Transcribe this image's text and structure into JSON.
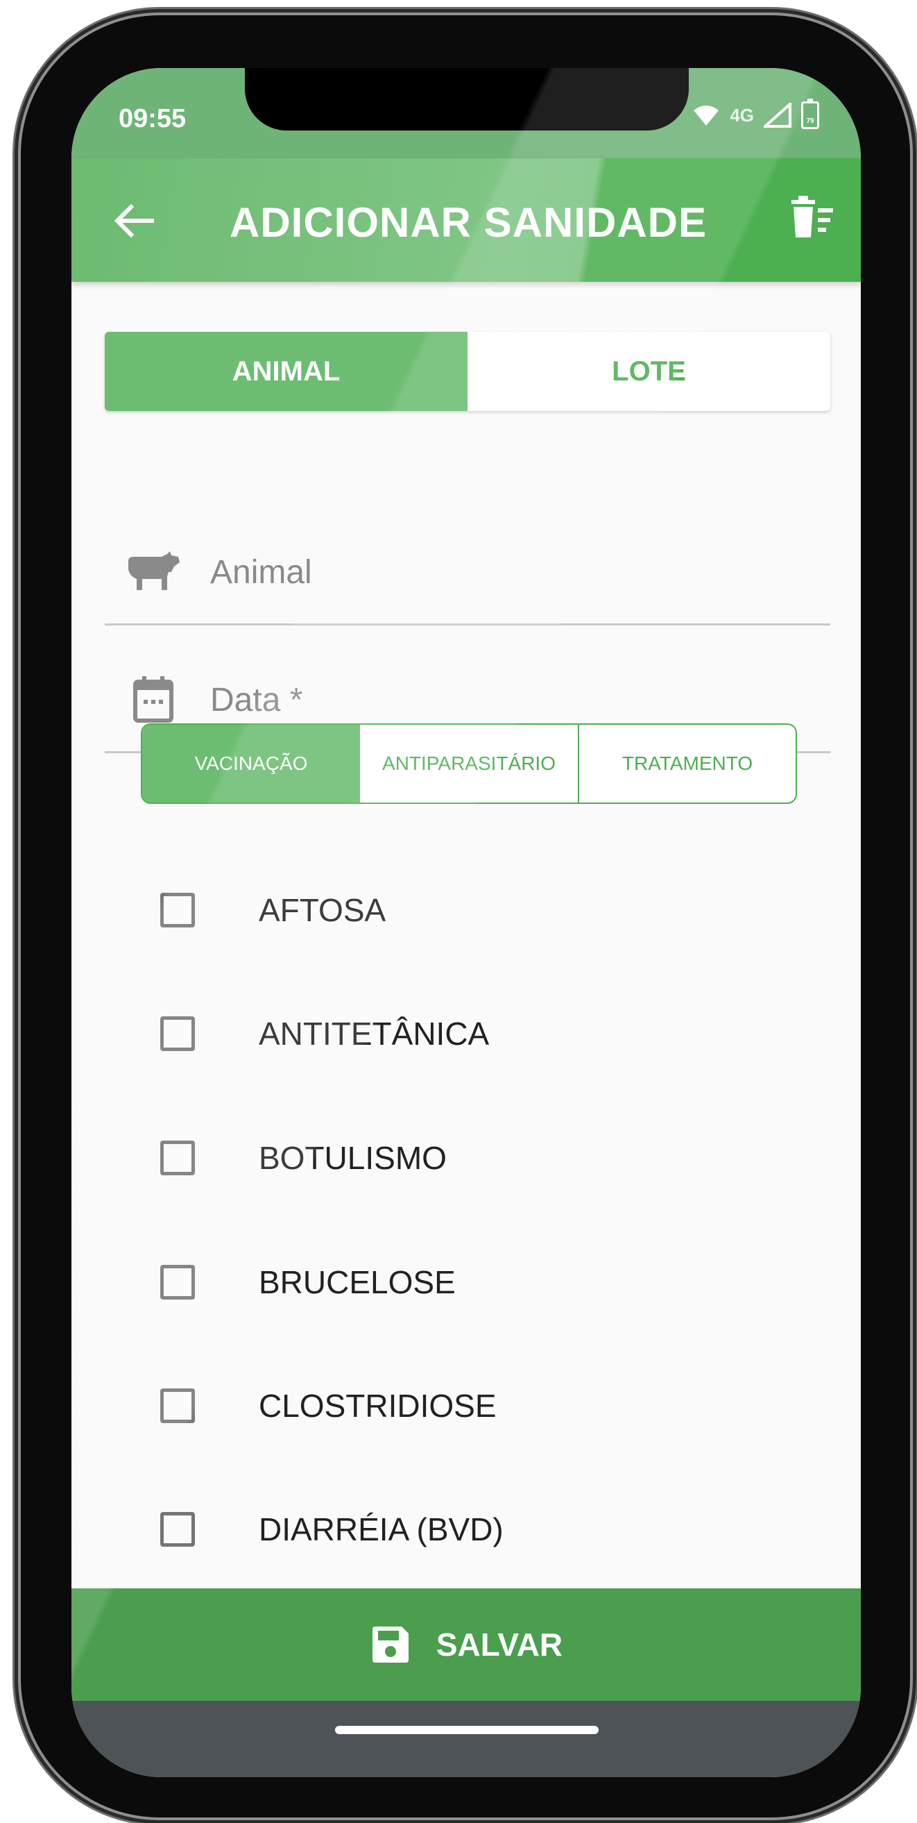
{
  "status_bar": {
    "time": "09:55",
    "network": "4G",
    "battery": "79"
  },
  "app_bar": {
    "title": "ADICIONAR SANIDADE"
  },
  "scope_tabs": [
    {
      "label": "ANIMAL",
      "active": true
    },
    {
      "label": "LOTE",
      "active": false
    }
  ],
  "fields": {
    "animal": {
      "placeholder": "Animal",
      "value": ""
    },
    "date": {
      "placeholder": "Data *",
      "value": ""
    }
  },
  "type_tabs": [
    {
      "label": "VACINAÇÃO",
      "active": true
    },
    {
      "label": "ANTIPARASITÁRIO",
      "active": false
    },
    {
      "label": "TRATAMENTO",
      "active": false
    }
  ],
  "vaccines": [
    {
      "label": "AFTOSA",
      "checked": false
    },
    {
      "label": "ANTITETÂNICA",
      "checked": false
    },
    {
      "label": "BOTULISMO",
      "checked": false
    },
    {
      "label": "BRUCELOSE",
      "checked": false
    },
    {
      "label": "CLOSTRIDIOSE",
      "checked": false
    },
    {
      "label": "DIARRÉIA (BVD)",
      "checked": false
    }
  ],
  "save_button": {
    "label": "SALVAR"
  },
  "colors": {
    "primary": "#4caf50",
    "primary_light": "#6cbd72",
    "status_bar": "#6fb477",
    "nav_bar": "#4d5357"
  }
}
